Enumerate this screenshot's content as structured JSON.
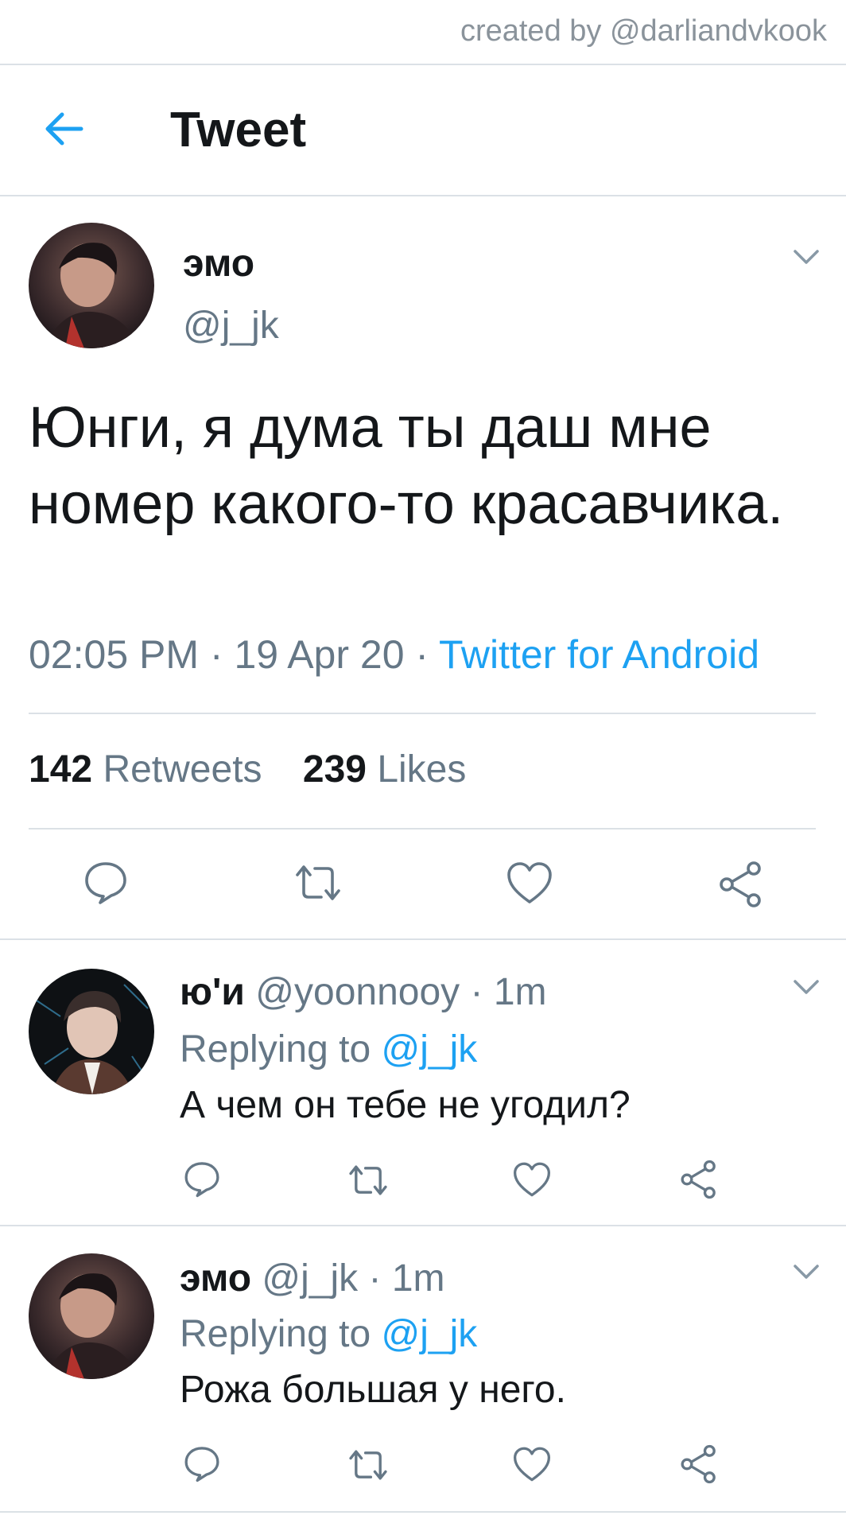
{
  "credit": "created by @darliandvkook",
  "header": {
    "title": "Tweet",
    "back_icon": "back-arrow-icon"
  },
  "tweet": {
    "author_name": "эмо",
    "author_handle": "@j_jk",
    "text": "Юнги, я дума ты даш мне номер какого-то красавчика.",
    "time": "02:05 PM",
    "date": "19 Apr 20",
    "separator": " · ",
    "source": "Twitter for Android",
    "retweets_count": "142",
    "retweets_label": "Retweets",
    "likes_count": "239",
    "likes_label": "Likes"
  },
  "replies": [
    {
      "name": "ю'и",
      "handle": "@yoonnooy",
      "age": "· 1m",
      "replying_label": "Replying to",
      "replying_to": "@j_jk",
      "text": "А чем он тебе не угодил?"
    },
    {
      "name": "эмо",
      "handle": "@j_jk",
      "age": "· 1m",
      "replying_label": "Replying to",
      "replying_to": "@j_jk",
      "text": "Рожа большая у него."
    }
  ],
  "colors": {
    "accent": "#1da1f2",
    "muted": "#657786",
    "divider": "#dbe1e6",
    "text": "#14171a"
  }
}
